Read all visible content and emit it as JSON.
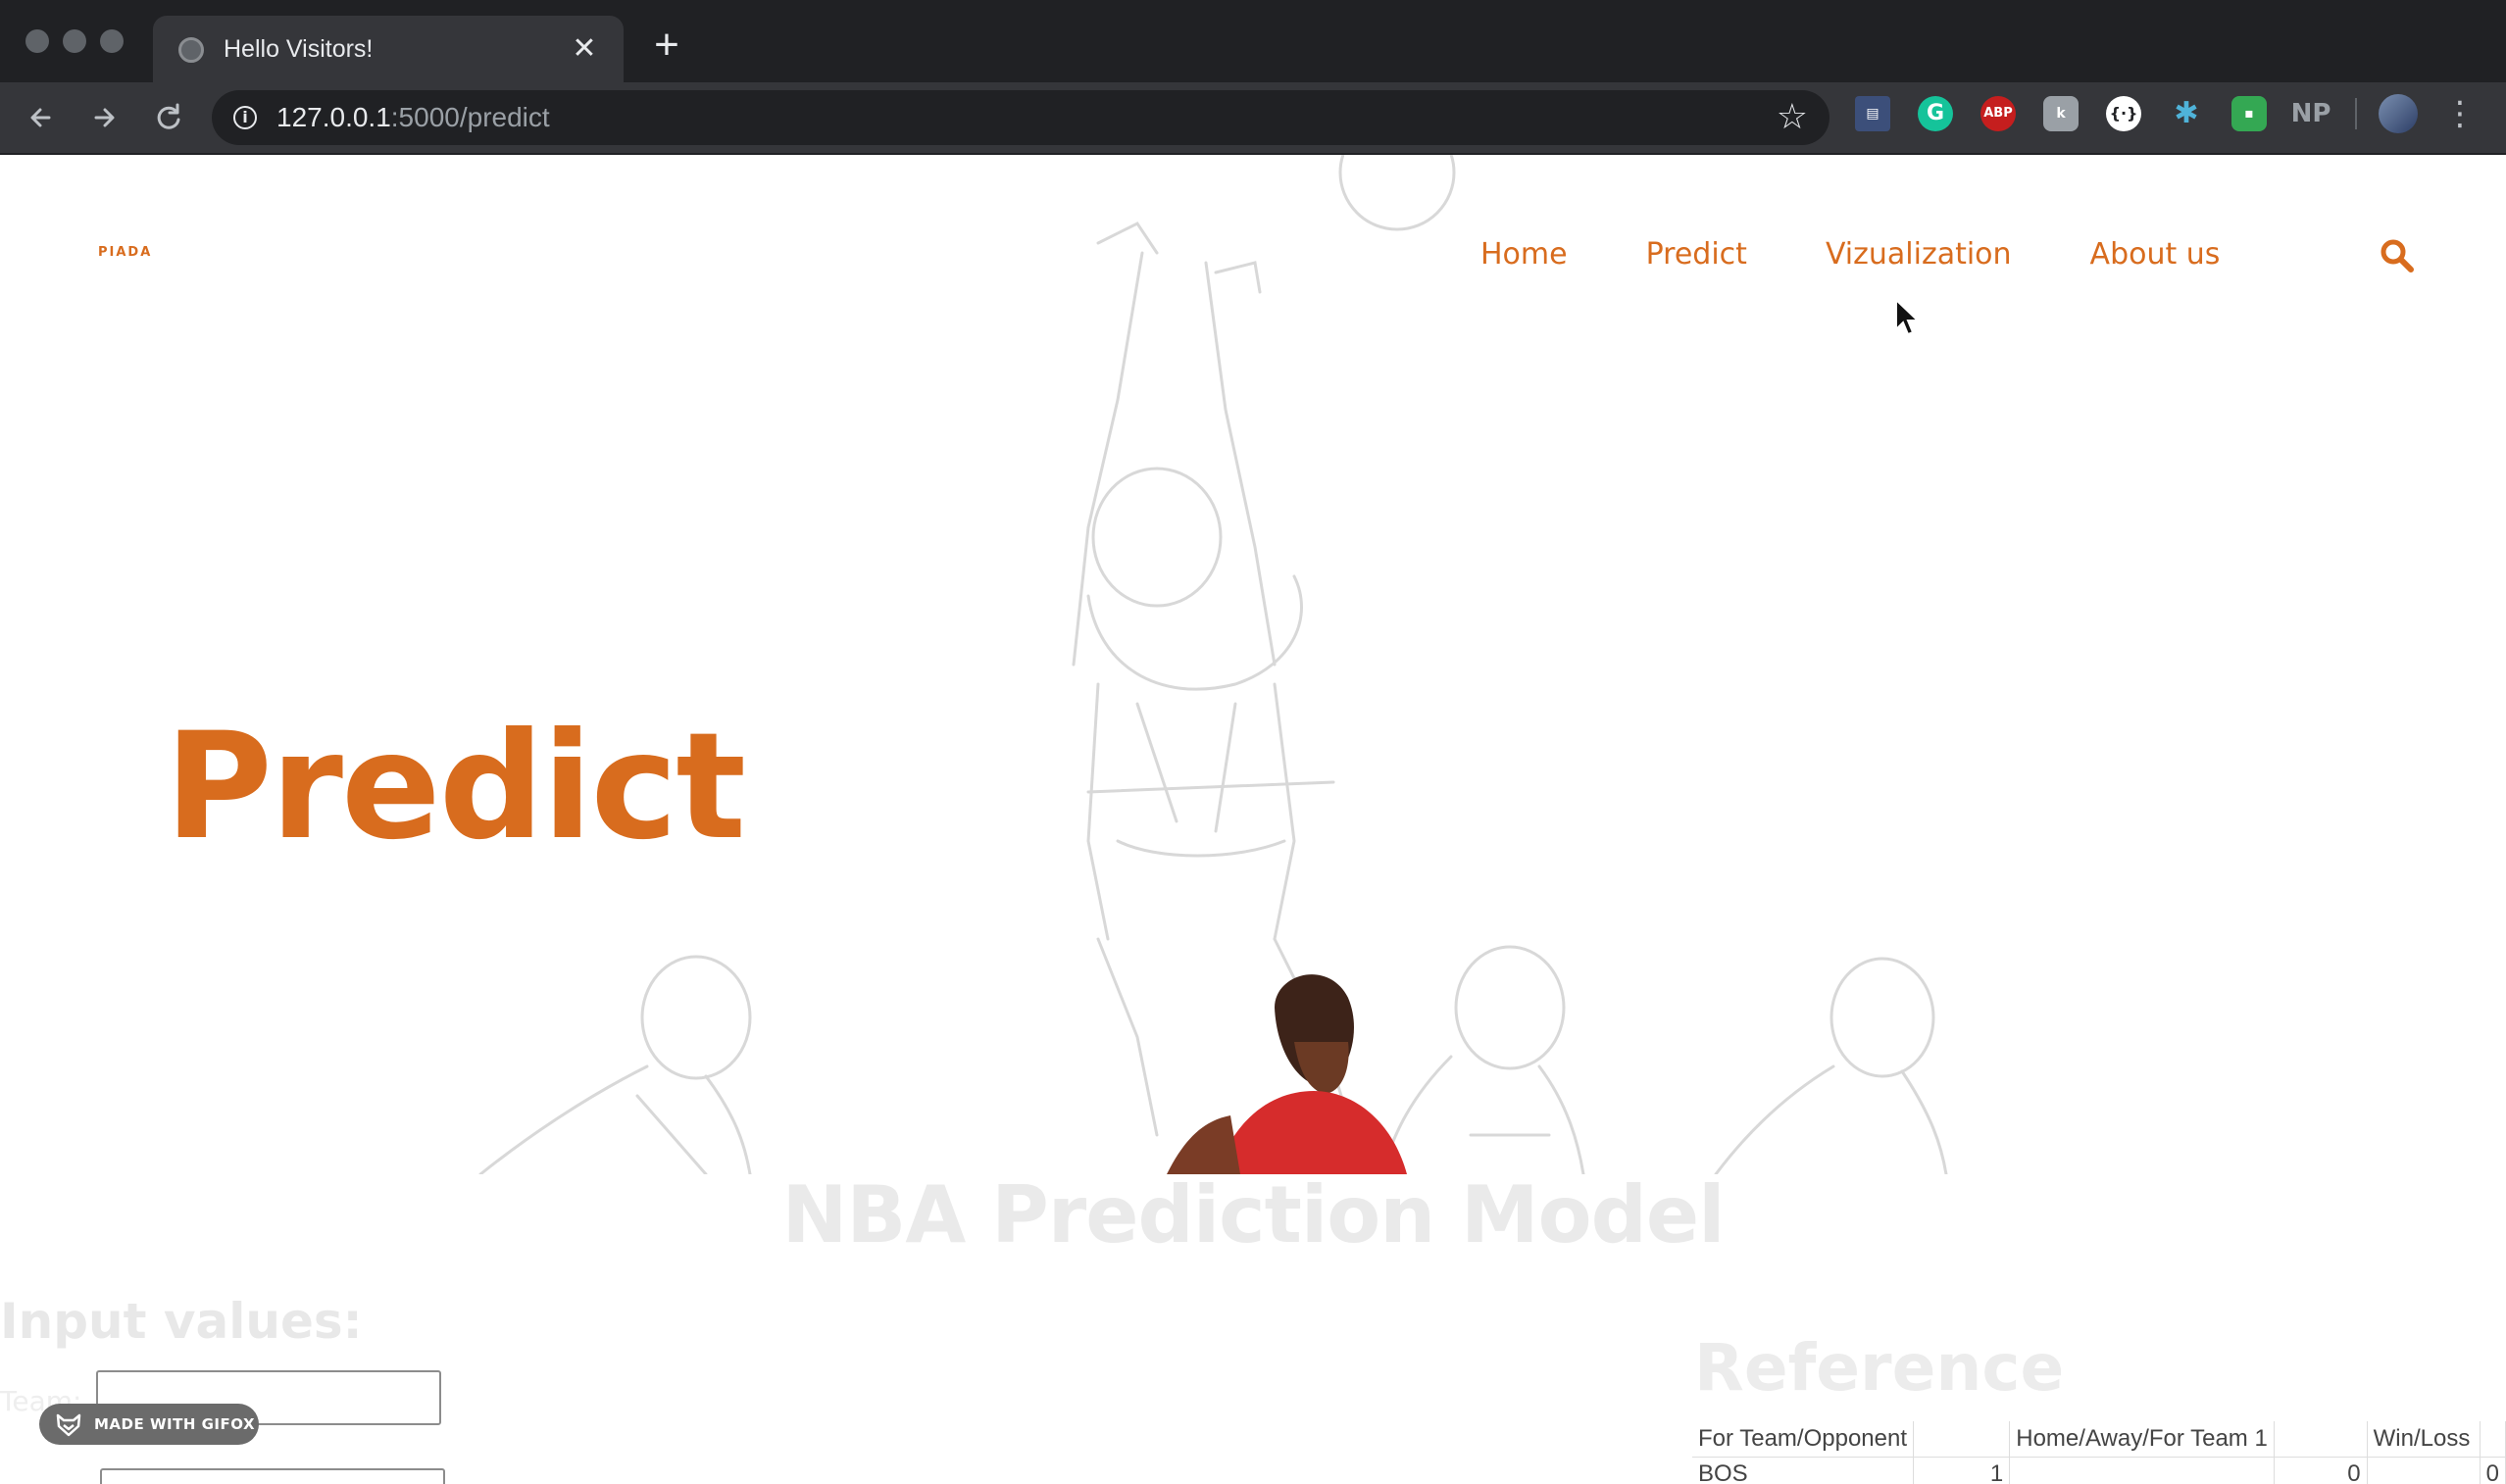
{
  "browser": {
    "tab_title": "Hello Visitors!",
    "tab_close": "✕",
    "new_tab": "+",
    "url_host": "127.0.0.1",
    "url_path": ":5000/predict",
    "extensions": [
      "calendar-extension-icon",
      "grammarly-icon",
      "adblock-plus-icon",
      "extension-icon",
      "extension-icon",
      "extension-icon",
      "extension-icon",
      "np-extension-icon"
    ],
    "ext_abp_label": "ABP",
    "ext_np_label": "NP"
  },
  "site": {
    "logo": "PIADA",
    "nav": [
      {
        "label": "Home"
      },
      {
        "label": "Predict"
      },
      {
        "label": "Vizualization"
      },
      {
        "label": "About us"
      }
    ],
    "accent_color": "#d86c1e"
  },
  "hero": {
    "title": "Predict"
  },
  "main": {
    "section_title": "NBA Prediction Model",
    "input_heading": "Input values:",
    "team_label": "Team:"
  },
  "badge": {
    "label": "MADE WITH GIFOX"
  },
  "reference": {
    "heading": "Reference",
    "headers": [
      "For Team/Opponent",
      "",
      "Home/Away/For Team 1",
      "",
      "Win/Loss"
    ],
    "rows": [
      [
        "BOS",
        "1",
        "",
        "0",
        "",
        "0"
      ]
    ]
  }
}
